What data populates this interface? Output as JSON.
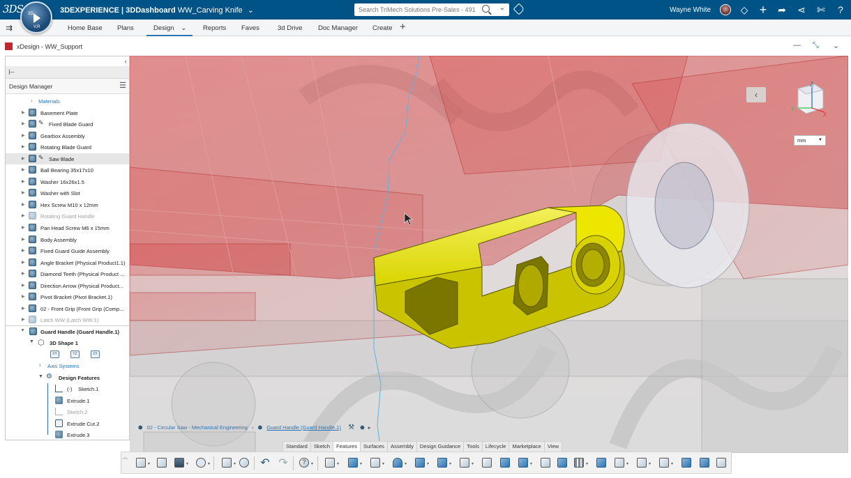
{
  "topbar": {
    "logo": "3DS",
    "compass_top": "3D",
    "compass_bottom": "V,R",
    "brand": "3DEXPERIENCE | 3DDashboard",
    "dashboard_name": "WW_Carving Knife",
    "search_placeholder": "Search TriMech Solutions Pre-Sales - 491",
    "user_name": "Wayne White",
    "icons": [
      "tag-icon",
      "share-icon",
      "add-icon",
      "forward-icon",
      "network-icon",
      "tools-icon",
      "help-icon"
    ],
    "background_color": "#005386"
  },
  "nav": {
    "tabs": [
      "Home Base",
      "Plans",
      "Design",
      "Reports",
      "Faves",
      "3d Drive",
      "Doc Manager",
      "Create"
    ],
    "active_tab": "Design"
  },
  "widget": {
    "title": "xDesign - WW_Support"
  },
  "panel": {
    "header": "Design Manager",
    "items": [
      {
        "label": "Materials",
        "type": "link"
      },
      {
        "label": "Basement Plate"
      },
      {
        "label": "Fixed Blade Guard",
        "pen": true
      },
      {
        "label": "Gearbox Assembly"
      },
      {
        "label": "Rotating Blade Guard"
      },
      {
        "label": "Saw Blade",
        "pen": true,
        "selected": true
      },
      {
        "label": "Ball Bearing 35x17x10"
      },
      {
        "label": "Washer 16x26x1.5"
      },
      {
        "label": "Washer with Slot"
      },
      {
        "label": "Hex Screw M10 x 12mm"
      },
      {
        "label": "Rotating Guard Handle",
        "dim": true
      },
      {
        "label": "Pan Head Screw M6 x 15mm"
      },
      {
        "label": "Body Assembly"
      },
      {
        "label": "Fixed Guard Guide Assembly"
      },
      {
        "label": "Angle Bracket (Physical Product1.1)"
      },
      {
        "label": "Diamond Teeth (Physical Product ..."
      },
      {
        "label": "Direction Arrow (Physical Product..."
      },
      {
        "label": "Pivot Bracket (Pivot Bracket.1)"
      },
      {
        "label": "02 - Front Grip (Front Grip (Comp..."
      },
      {
        "label": "Latch WW (Latch WW.1)",
        "dim": true
      }
    ],
    "active_part": "Guard Handle (Guard Handle.1)",
    "shape": "3D Shape 1",
    "planes": [
      "XY",
      "YZ",
      "ZX"
    ],
    "axis_systems": "Axis Systems",
    "design_features": "Design Features",
    "features": [
      {
        "label": "Sketch.1",
        "prefix": "(-)"
      },
      {
        "label": "Extrude.1"
      },
      {
        "label": "Sketch.2",
        "dim": true
      },
      {
        "label": "Extrude Cut.2"
      },
      {
        "label": "Extrude.3"
      }
    ]
  },
  "breadcrumb": {
    "items": [
      "02 - Circular Saw - Mechanical Engineering",
      "Guard Handle (Guard Handle.1)"
    ]
  },
  "viewcube": {
    "z": "Z",
    "y": "Y",
    "x": "X"
  },
  "units": {
    "selected": "mm"
  },
  "action_bar": {
    "tabs": [
      "Standard",
      "Sketch",
      "Features",
      "Surfaces",
      "Assembly",
      "Design Guidance",
      "Tools",
      "Lifecycle",
      "Marketplace",
      "View"
    ],
    "active_tab": "Features"
  },
  "colors": {
    "part": "#e2e000",
    "transparent_body": "#d83a3a",
    "accent": "#2b74b5"
  }
}
